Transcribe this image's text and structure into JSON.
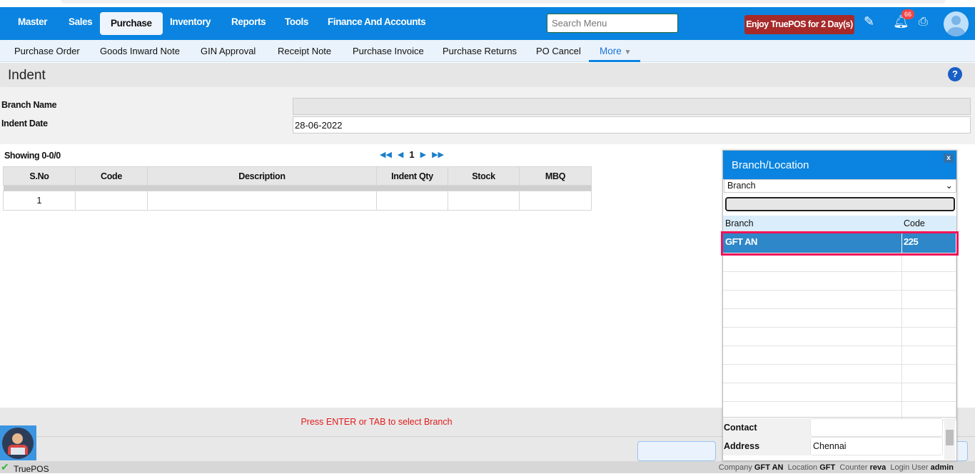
{
  "nav": {
    "items": [
      "Master",
      "Sales",
      "Purchase",
      "Inventory",
      "Reports",
      "Tools",
      "Finance And Accounts"
    ],
    "active": "Purchase",
    "search_placeholder": "Search Menu",
    "promo": "Enjoy TruePOS for 2 Day(s)",
    "notification_count": "66"
  },
  "subnav": {
    "items": [
      "Purchase Order",
      "Goods Inward Note",
      "GIN Approval",
      "Receipt Note",
      "Purchase Invoice",
      "Purchase Returns",
      "PO Cancel"
    ],
    "more": "More"
  },
  "page": {
    "title": "Indent",
    "help": "?"
  },
  "form": {
    "branch_label": "Branch Name",
    "branch_value": "",
    "date_label": "Indent Date",
    "date_value": "28-06-2022"
  },
  "grid": {
    "showing": "Showing 0-0/0",
    "page": "1",
    "columns": [
      "S.No",
      "Code",
      "Description",
      "Indent Qty",
      "Stock",
      "MBQ"
    ],
    "rows": [
      [
        "1",
        "",
        "",
        "",
        "",
        ""
      ]
    ]
  },
  "message": "Press ENTER or TAB to select Branch",
  "popup": {
    "title": "Branch/Location",
    "close": "x",
    "filter": "Branch",
    "search_value": "",
    "columns": [
      "Branch",
      "Code"
    ],
    "rows": [
      [
        "GFT AN",
        "225"
      ]
    ],
    "contact_label": "Contact",
    "contact_value": "",
    "address_label": "Address",
    "address_value": "Chennai"
  },
  "status": {
    "app": "TruePOS",
    "company_label": "Company",
    "company": "GFT AN",
    "location_label": "Location",
    "location": "GFT",
    "counter_label": "Counter",
    "counter": "reva",
    "user_label": "Login User",
    "user": "admin"
  },
  "colors": {
    "nav": "#0a84e0",
    "promo": "#a62a2a",
    "highlight": "#f0145a",
    "selected": "#2e87c8"
  }
}
